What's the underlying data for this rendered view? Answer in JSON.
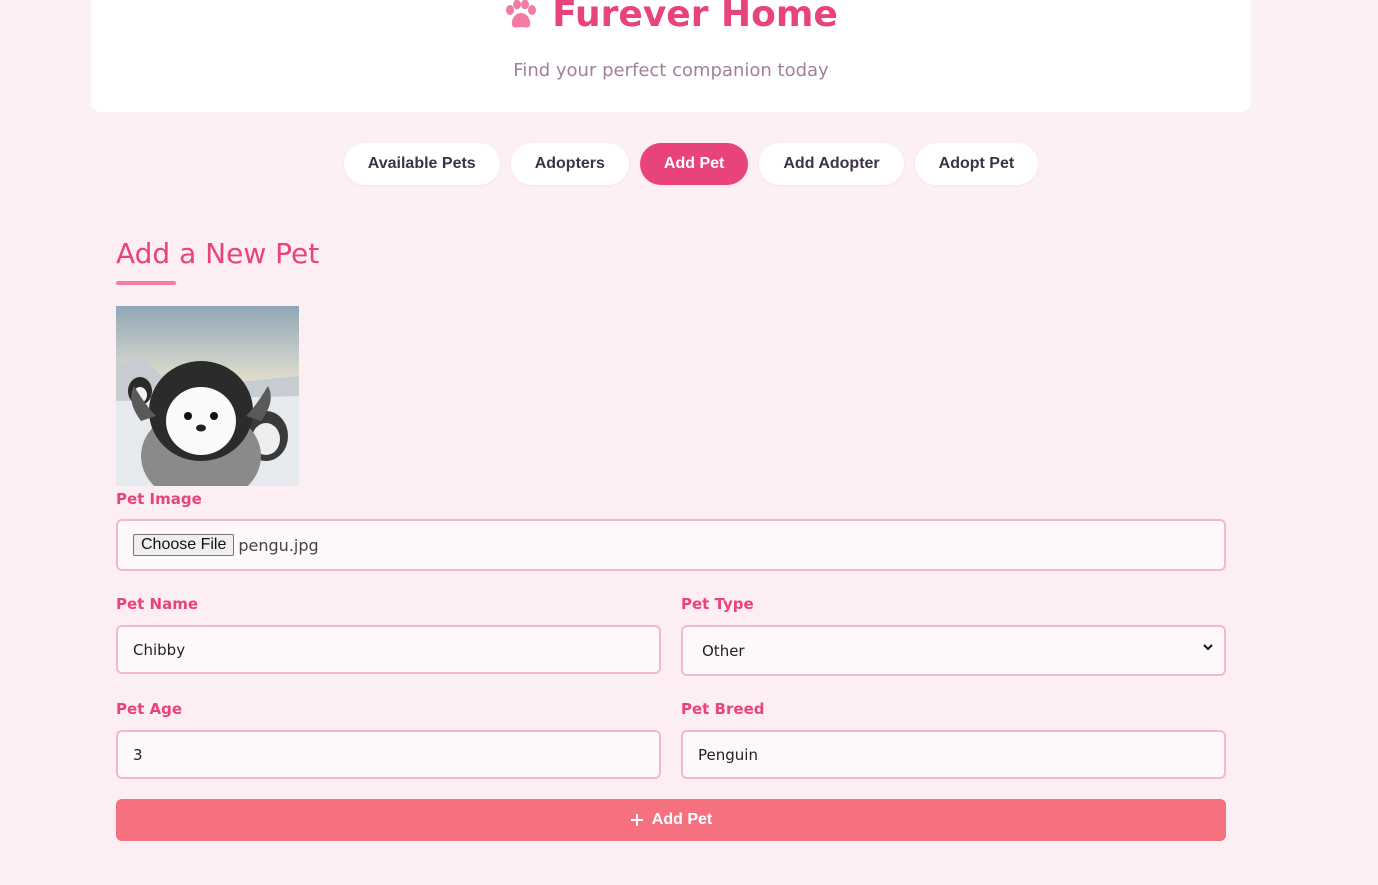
{
  "header": {
    "title": "Furever Home",
    "subtitle": "Find your perfect companion today",
    "logo_icon": "paw-icon"
  },
  "nav": {
    "tabs": [
      {
        "label": "Available Pets",
        "active": false
      },
      {
        "label": "Adopters",
        "active": false
      },
      {
        "label": "Add Pet",
        "active": true
      },
      {
        "label": "Add Adopter",
        "active": false
      },
      {
        "label": "Adopt Pet",
        "active": false
      }
    ]
  },
  "form": {
    "title": "Add a New Pet",
    "image": {
      "label": "Pet Image",
      "button_label": "Choose File",
      "file_name": "pengu.jpg"
    },
    "name": {
      "label": "Pet Name",
      "value": "Chibby"
    },
    "type": {
      "label": "Pet Type",
      "value": "Other"
    },
    "age": {
      "label": "Pet Age",
      "value": "3"
    },
    "breed": {
      "label": "Pet Breed",
      "value": "Penguin"
    },
    "submit_label": "Add Pet",
    "submit_icon": "plus-icon"
  },
  "colors": {
    "accent": "#e8437c",
    "submit": "#f57180",
    "background": "#fdf0f4"
  }
}
